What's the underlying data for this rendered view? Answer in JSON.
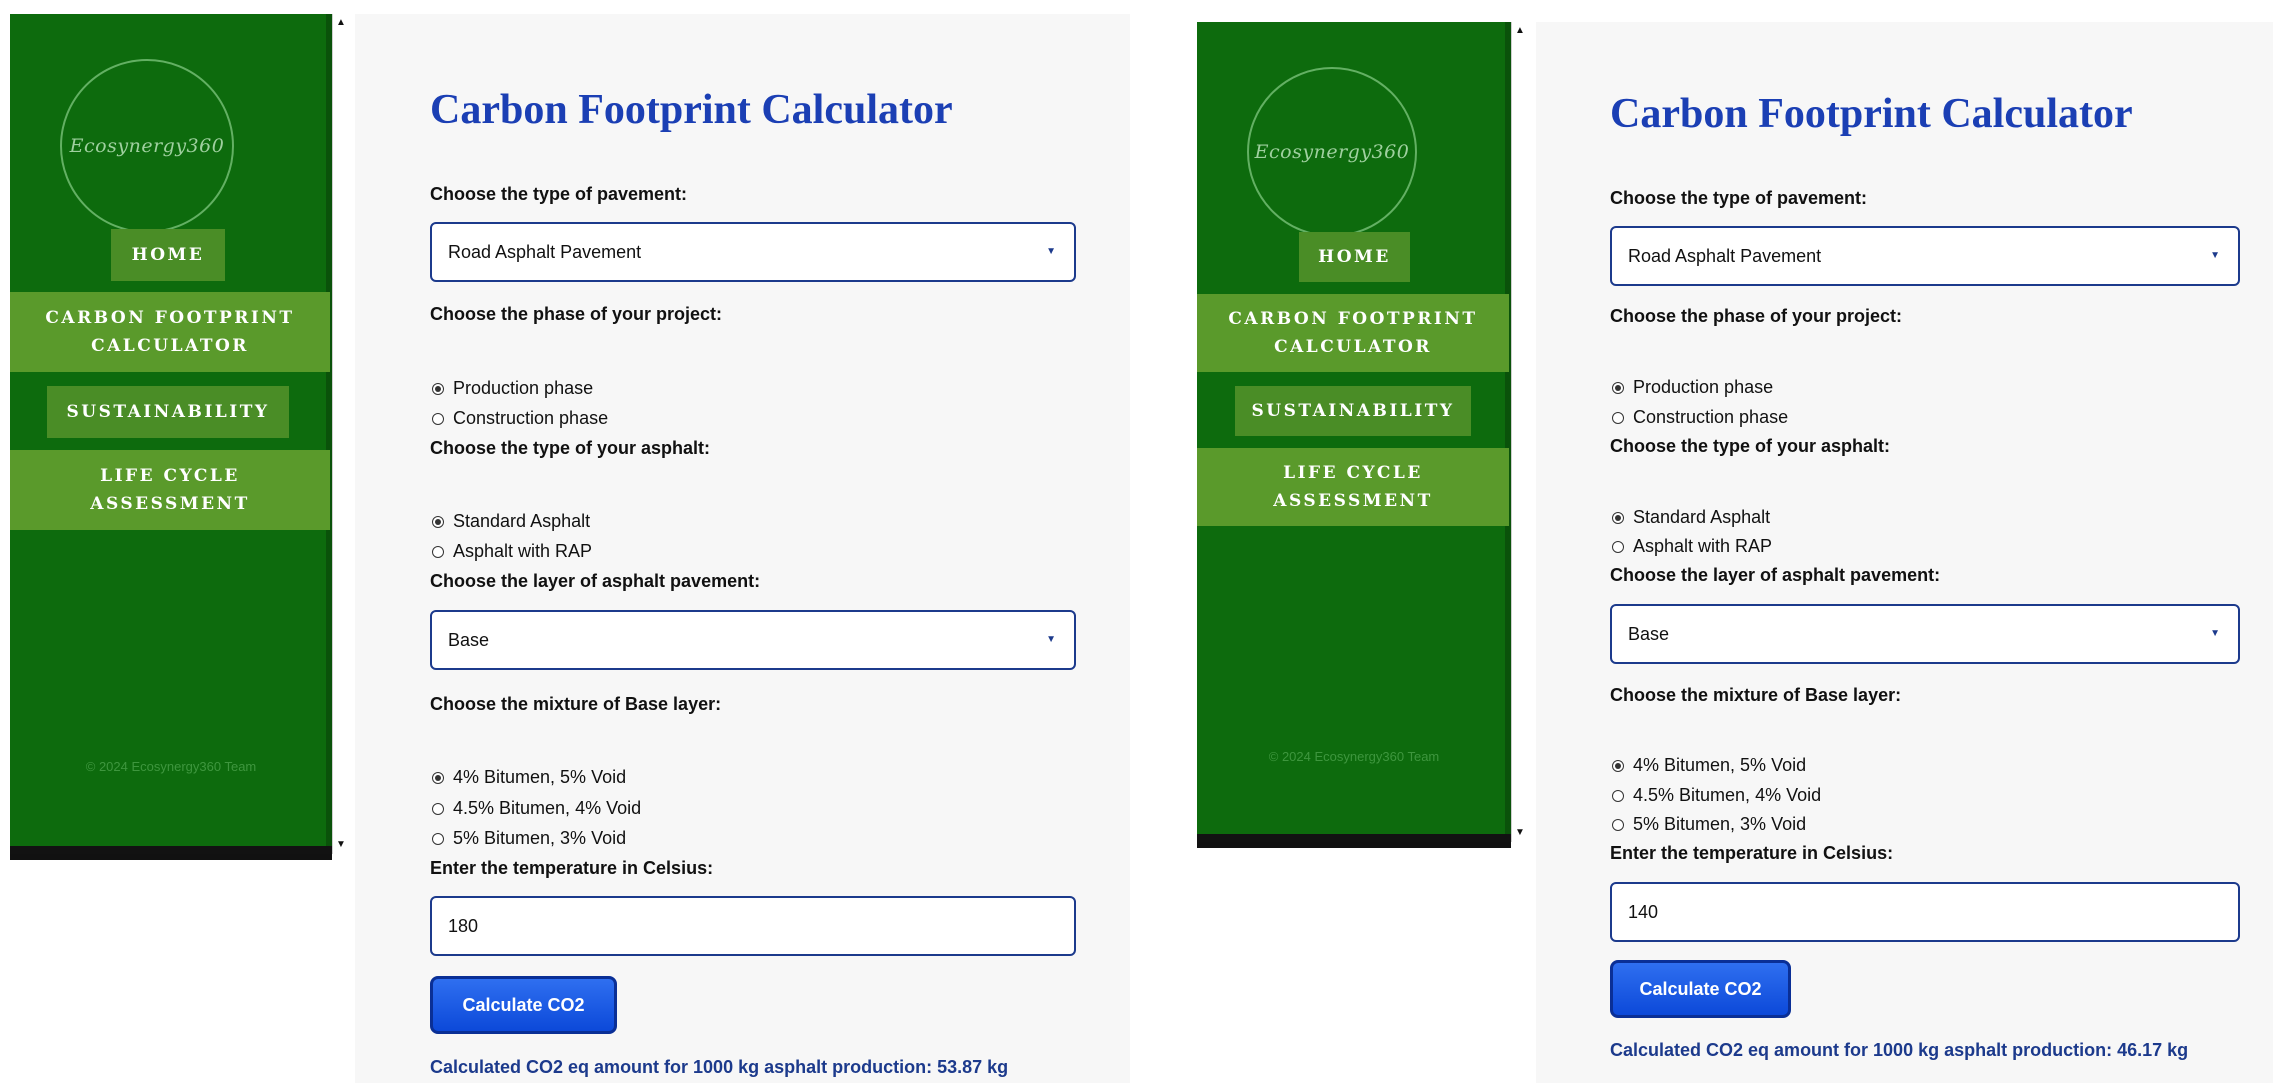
{
  "screens": [
    {
      "logo_text": "Ecosynergy360",
      "nav": [
        {
          "label": "HOME"
        },
        {
          "label": "CARBON FOOTPRINT CALCULATOR"
        },
        {
          "label": "SUSTAINABILITY"
        },
        {
          "label": "LIFE CYCLE ASSESSMENT"
        }
      ],
      "copyright": "© 2024 Ecosynergy360 Team",
      "title": "Carbon Footprint Calculator",
      "pavement_label": "Choose the type of pavement:",
      "pavement_value": "Road Asphalt Pavement",
      "phase_label": "Choose the phase of your project:",
      "phase_options": [
        "Production phase",
        "Construction phase"
      ],
      "asphalt_label": "Choose the type of your asphalt:",
      "asphalt_options": [
        "Standard Asphalt",
        "Asphalt with RAP"
      ],
      "layer_label": "Choose the layer of asphalt pavement:",
      "layer_value": "Base",
      "mixture_label": "Choose the mixture of Base layer:",
      "mixture_options": [
        "4% Bitumen, 5% Void",
        "4.5% Bitumen, 4% Void",
        "5% Bitumen, 3% Void"
      ],
      "temp_label": "Enter the temperature in Celsius:",
      "temp_value": "180",
      "button_label": "Calculate CO2",
      "result": "Calculated CO2 eq amount for 1000 kg asphalt production: 53.87 kg"
    },
    {
      "logo_text": "Ecosynergy360",
      "nav": [
        {
          "label": "HOME"
        },
        {
          "label": "CARBON FOOTPRINT CALCULATOR"
        },
        {
          "label": "SUSTAINABILITY"
        },
        {
          "label": "LIFE CYCLE ASSESSMENT"
        }
      ],
      "copyright": "© 2024 Ecosynergy360 Team",
      "title": "Carbon Footprint Calculator",
      "pavement_label": "Choose the type of pavement:",
      "pavement_value": "Road Asphalt Pavement",
      "phase_label": "Choose the phase of your project:",
      "phase_options": [
        "Production phase",
        "Construction phase"
      ],
      "asphalt_label": "Choose the type of your asphalt:",
      "asphalt_options": [
        "Standard Asphalt",
        "Asphalt with RAP"
      ],
      "layer_label": "Choose the layer of asphalt pavement:",
      "layer_value": "Base",
      "mixture_label": "Choose the mixture of Base layer:",
      "mixture_options": [
        "4% Bitumen, 5% Void",
        "4.5% Bitumen, 4% Void",
        "5% Bitumen, 3% Void"
      ],
      "temp_label": "Enter the temperature in Celsius:",
      "temp_value": "140",
      "button_label": "Calculate CO2",
      "result": "Calculated CO2 eq amount for 1000 kg asphalt production: 46.17 kg"
    }
  ]
}
